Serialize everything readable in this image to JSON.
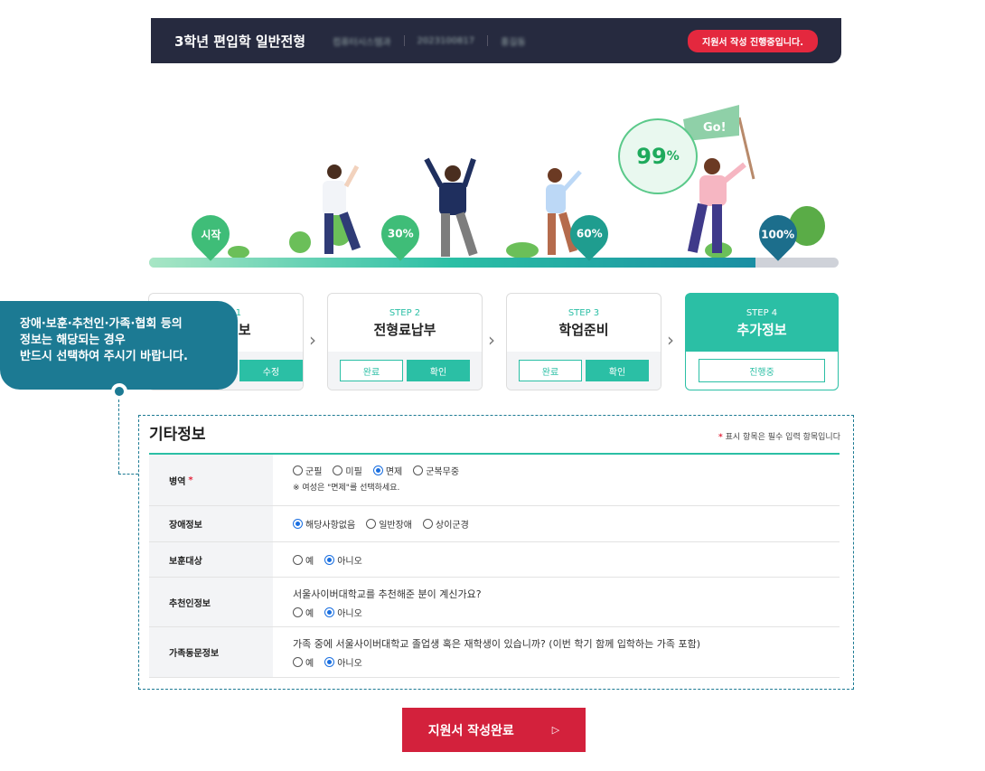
{
  "header": {
    "title": "3학년 편입학 일반전형",
    "meta": [
      "컴퓨터시스템과",
      "2023100817",
      "홍길동"
    ],
    "status_badge": "지원서 작성 진행중입니다."
  },
  "progress": {
    "markers": [
      "시작",
      "30%",
      "60%",
      "100%"
    ],
    "current_percent": "99",
    "percent_sign": "%",
    "flag_text": "Go!",
    "fill_fraction": 0.88
  },
  "steps": [
    {
      "label": "STEP 1",
      "name": "기본정보",
      "btn_a": "",
      "btn_b": "수정"
    },
    {
      "label": "STEP 2",
      "name": "전형료납부",
      "btn_a": "완료",
      "btn_b": "확인"
    },
    {
      "label": "STEP 3",
      "name": "학업준비",
      "btn_a": "완료",
      "btn_b": "확인"
    },
    {
      "label": "STEP 4",
      "name": "추가정보",
      "btn_status": "진행중"
    }
  ],
  "tooltip": {
    "line1": "장애·보훈·추천인·가족·협회 등의",
    "line2": "정보는 해당되는 경우",
    "line3": "반드시 선택하여 주시기 바랍니다."
  },
  "form": {
    "title": "기타정보",
    "required_mark": "*",
    "required_note": "표시 항목은 필수 입력 항목입니다",
    "military": {
      "label": "병역",
      "options": [
        "군필",
        "미필",
        "면제",
        "군복무중"
      ],
      "selected": "면제",
      "note": "※ 여성은 \"면제\"를 선택하세요."
    },
    "disability": {
      "label": "장애정보",
      "options": [
        "해당사항없음",
        "일반장애",
        "상이군경"
      ],
      "selected": "해당사항없음"
    },
    "veteran": {
      "label": "보훈대상",
      "options": [
        "예",
        "아니오"
      ],
      "selected": "아니오"
    },
    "referrer": {
      "label": "추천인정보",
      "question": "서울사이버대학교를 추천해준 분이 계신가요?",
      "options": [
        "예",
        "아니오"
      ],
      "selected": "아니오"
    },
    "family": {
      "label": "가족동문정보",
      "question": "가족 중에 서울사이버대학교 졸업생 혹은 재학생이 있습니까? (이번 학기 함께 입학하는 가족 포함)",
      "options": [
        "예",
        "아니오"
      ],
      "selected": "아니오"
    }
  },
  "submit": {
    "label": "지원서 작성완료",
    "icon": "play-icon"
  },
  "colors": {
    "accent": "#2bbfa5",
    "header": "#262a3f",
    "danger": "#d3213c",
    "tooltip": "#1c7a93"
  }
}
